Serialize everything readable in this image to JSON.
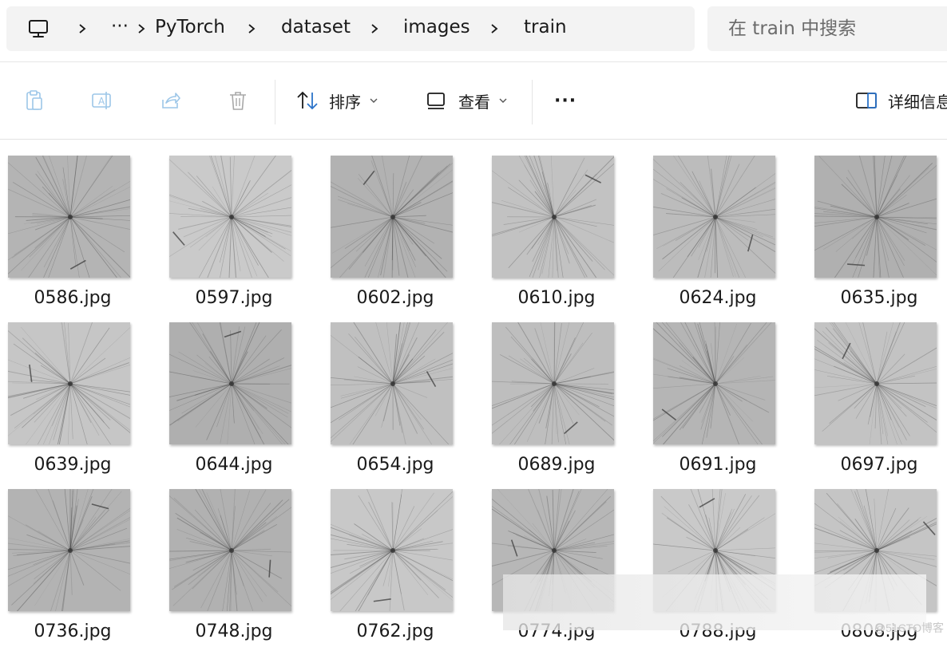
{
  "address": {
    "crumbs": [
      "PyTorch",
      "dataset",
      "images",
      "train"
    ],
    "ellipsis": "···",
    "search_placeholder": "在 train 中搜索"
  },
  "toolbar": {
    "sort_label": "排序",
    "view_label": "查看",
    "more_label": "···",
    "details_label": "详细信息"
  },
  "files": [
    {
      "name": "0586.jpg",
      "shade": "#b4b4b4"
    },
    {
      "name": "0597.jpg",
      "shade": "#cacaca"
    },
    {
      "name": "0602.jpg",
      "shade": "#b2b2b2"
    },
    {
      "name": "0610.jpg",
      "shade": "#c2c2c2"
    },
    {
      "name": "0624.jpg",
      "shade": "#bcbcbc"
    },
    {
      "name": "0635.jpg",
      "shade": "#b0b0b0"
    },
    {
      "name": "0639.jpg",
      "shade": "#c6c6c6"
    },
    {
      "name": "0644.jpg",
      "shade": "#afafaf"
    },
    {
      "name": "0654.jpg",
      "shade": "#c0c0c0"
    },
    {
      "name": "0689.jpg",
      "shade": "#bebebe"
    },
    {
      "name": "0691.jpg",
      "shade": "#b5b5b5"
    },
    {
      "name": "0697.jpg",
      "shade": "#c3c3c3"
    },
    {
      "name": "0736.jpg",
      "shade": "#b3b3b3"
    },
    {
      "name": "0748.jpg",
      "shade": "#b1b1b1"
    },
    {
      "name": "0762.jpg",
      "shade": "#c8c8c8"
    },
    {
      "name": "0774.jpg",
      "shade": "#b7b7b7"
    },
    {
      "name": "0788.jpg",
      "shade": "#c9c9c9"
    },
    {
      "name": "0808.jpg",
      "shade": "#c5c5c5"
    }
  ],
  "watermark": "@51CTO博客"
}
